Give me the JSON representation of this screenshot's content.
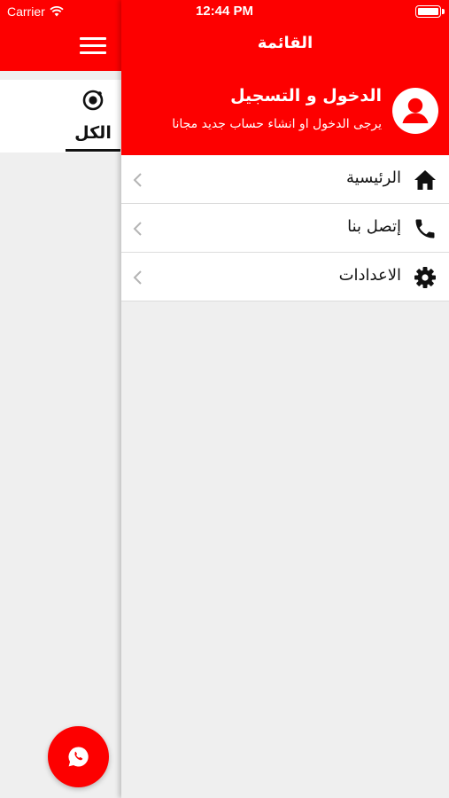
{
  "status_bar": {
    "carrier": "Carrier",
    "time": "12:44 PM"
  },
  "background_app": {
    "category_tab": "الكل"
  },
  "drawer": {
    "title": "القائمة",
    "profile": {
      "title": "الدخول و التسجيل",
      "subtitle": "يرجى الدخول او انشاء حساب جديد مجانا"
    },
    "menu_items": [
      {
        "label": "الرئيسية",
        "icon": "home-icon"
      },
      {
        "label": "إتصل بنا",
        "icon": "phone-icon"
      },
      {
        "label": "الاعدادات",
        "icon": "gear-icon"
      }
    ]
  },
  "colors": {
    "brand_red": "#fd0000",
    "background": "#efefef",
    "text": "#111111"
  }
}
